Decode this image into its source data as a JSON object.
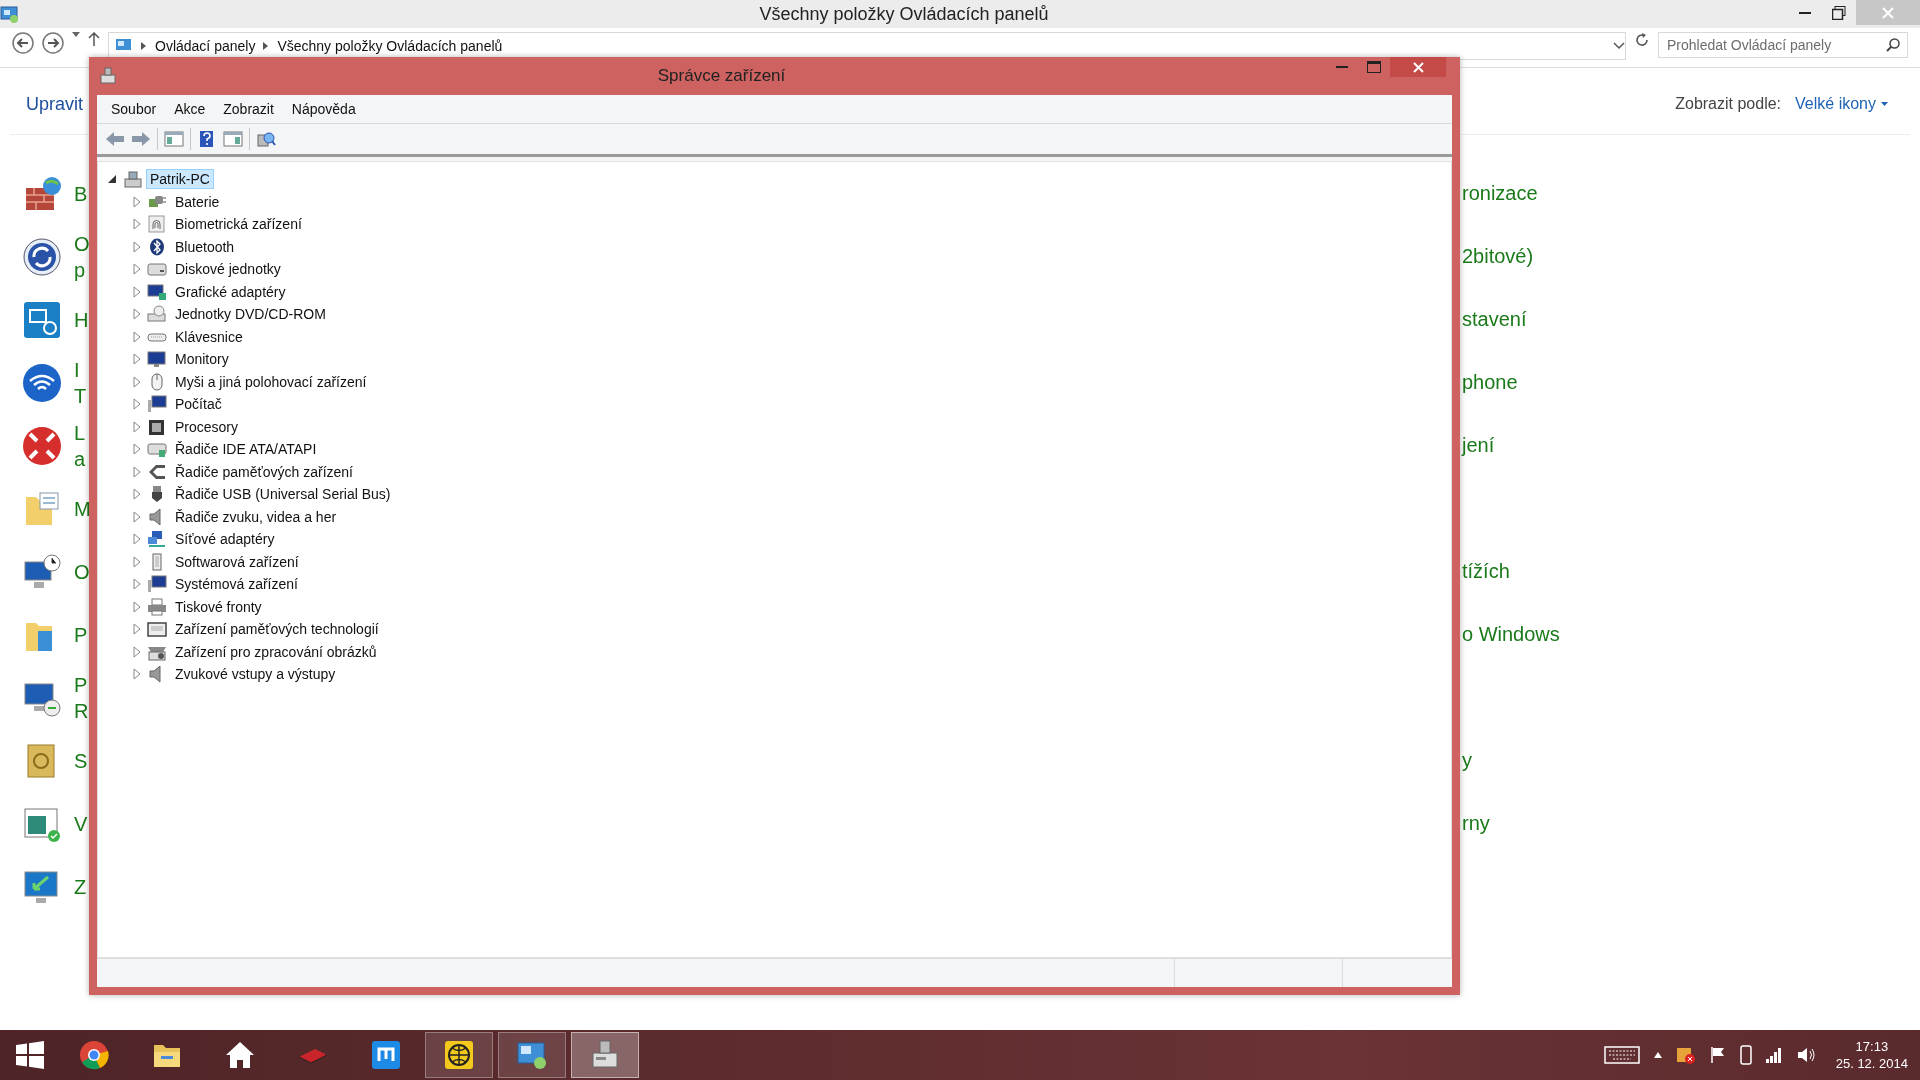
{
  "explorer": {
    "title": "Všechny položky Ovládacích panelů",
    "breadcrumb": [
      "Ovládací panely",
      "Všechny položky Ovládacích panelů"
    ],
    "search": {
      "placeholder": "Prohledat Ovládací panely"
    },
    "header_link": "Upravit",
    "view_label": "Zobrazit podle:",
    "view_value": "Velké ikony",
    "items": [
      {
        "left": [
          "B"
        ],
        "right": "ronizace"
      },
      {
        "left": [
          "O",
          "p"
        ],
        "right": "2bitové)"
      },
      {
        "left": [
          "H"
        ],
        "right": "stavení"
      },
      {
        "left": [
          "I",
          "T"
        ],
        "right": "phone"
      },
      {
        "left": [
          "L",
          "a"
        ],
        "right": "jení"
      },
      {
        "left": [
          "M"
        ]
      },
      {
        "left": [
          "O"
        ],
        "right": "tížích"
      },
      {
        "left": [
          "P"
        ],
        "right": "o Windows"
      },
      {
        "left": [
          "P",
          "R"
        ]
      },
      {
        "left": [
          "S"
        ],
        "right": "y"
      },
      {
        "left": [
          "V"
        ],
        "right": "rny"
      },
      {
        "left": [
          "Z"
        ]
      }
    ]
  },
  "dialog": {
    "title": "Správce zařízení",
    "menu": [
      "Soubor",
      "Akce",
      "Zobrazit",
      "Nápověda"
    ],
    "tree": {
      "label": "Patrik-PC",
      "expanded": true,
      "selected": true,
      "children": [
        {
          "label": "Baterie",
          "expanded": false,
          "selected": false
        },
        {
          "label": "Biometrická zařízení",
          "expanded": false,
          "selected": false
        },
        {
          "label": "Bluetooth",
          "expanded": false,
          "selected": false
        },
        {
          "label": "Diskové jednotky",
          "expanded": false,
          "selected": false
        },
        {
          "label": "Grafické adaptéry",
          "expanded": false,
          "selected": false
        },
        {
          "label": "Jednotky DVD/CD-ROM",
          "expanded": false,
          "selected": false
        },
        {
          "label": "Klávesnice",
          "expanded": false,
          "selected": false
        },
        {
          "label": "Monitory",
          "expanded": false,
          "selected": false
        },
        {
          "label": "Myši a jiná polohovací zařízení",
          "expanded": false,
          "selected": false
        },
        {
          "label": "Počítač",
          "expanded": false,
          "selected": false
        },
        {
          "label": "Procesory",
          "expanded": false,
          "selected": false
        },
        {
          "label": "Řadiče IDE ATA/ATAPI",
          "expanded": false,
          "selected": false
        },
        {
          "label": "Řadiče paměťových zařízení",
          "expanded": false,
          "selected": false
        },
        {
          "label": "Řadiče USB (Universal Serial Bus)",
          "expanded": false,
          "selected": false
        },
        {
          "label": "Řadiče zvuku, videa a her",
          "expanded": false,
          "selected": false
        },
        {
          "label": "Síťové adaptéry",
          "expanded": false,
          "selected": false
        },
        {
          "label": "Softwarová zařízení",
          "expanded": false,
          "selected": false
        },
        {
          "label": "Systémová zařízení",
          "expanded": false,
          "selected": false
        },
        {
          "label": "Tiskové fronty",
          "expanded": false,
          "selected": false
        },
        {
          "label": "Zařízení paměťových technologií",
          "expanded": false,
          "selected": false
        },
        {
          "label": "Zařízení pro zpracování obrázků",
          "expanded": false,
          "selected": false
        },
        {
          "label": "Zvukové vstupy a výstupy",
          "expanded": false,
          "selected": false
        }
      ]
    }
  },
  "taskbar": {
    "apps": [
      {
        "running": false,
        "active": false
      },
      {
        "running": false,
        "active": false
      },
      {
        "running": false,
        "active": false
      },
      {
        "running": false,
        "active": false
      },
      {
        "running": false,
        "active": false
      },
      {
        "running": true,
        "active": false
      },
      {
        "running": true,
        "active": false
      },
      {
        "running": true,
        "active": true
      }
    ],
    "clock": {
      "time": "17:13",
      "date": "25. 12. 2014"
    }
  }
}
